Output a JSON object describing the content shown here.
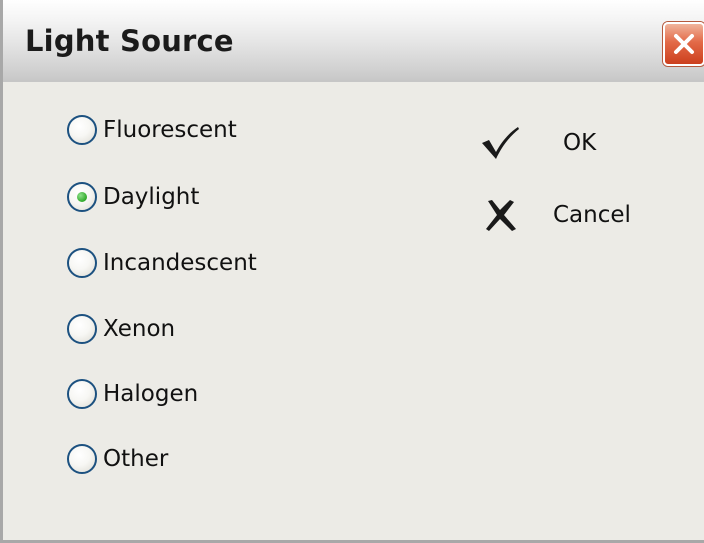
{
  "window": {
    "title": "Light Source",
    "close_icon": "close-x-icon",
    "close_button_color": "#d9512b"
  },
  "light_source_options": [
    {
      "label": "Fluorescent",
      "selected": false
    },
    {
      "label": "Daylight",
      "selected": true
    },
    {
      "label": "Incandescent",
      "selected": false
    },
    {
      "label": "Xenon",
      "selected": false
    },
    {
      "label": "Halogen",
      "selected": false
    },
    {
      "label": "Other",
      "selected": false
    }
  ],
  "actions": {
    "ok_label": "OK",
    "ok_icon": "checkmark-icon",
    "cancel_label": "Cancel",
    "cancel_icon": "cross-icon"
  },
  "colors": {
    "dialog_background": "#ecebe6",
    "radio_border": "#1c5180",
    "radio_selected_dot": "#2fa92a"
  }
}
